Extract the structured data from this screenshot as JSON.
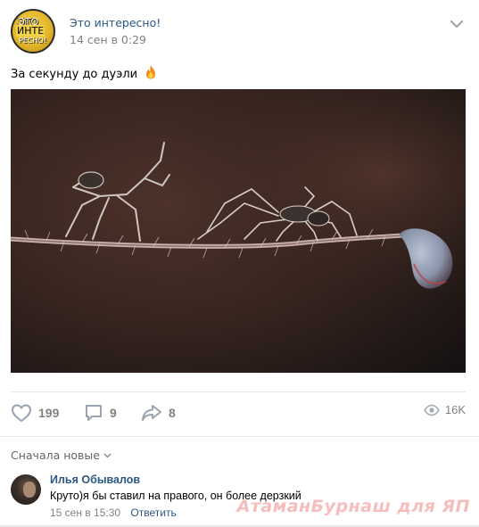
{
  "post": {
    "group_name": "Это интересно!",
    "date": "14 сен в 0:29",
    "text": "За секунду до дуэли",
    "avatar_text": [
      "ЭТО",
      "ИНТЕ",
      "РЕСНО!"
    ]
  },
  "actions": {
    "likes": "199",
    "comments": "9",
    "shares": "8",
    "views": "16K"
  },
  "comments_section": {
    "sort_label": "Сначала новые",
    "items": [
      {
        "author": "Илья Обывалов",
        "text": "Круто)я бы ставил на правого, он более дерзкий",
        "time": "15 сен в 15:30",
        "reply_label": "Ответить"
      }
    ]
  },
  "watermark": "АтаманБурнаш для ЯП",
  "colors": {
    "link": "#2a5885",
    "muted": "#828282",
    "divider": "#e7e8ec"
  }
}
